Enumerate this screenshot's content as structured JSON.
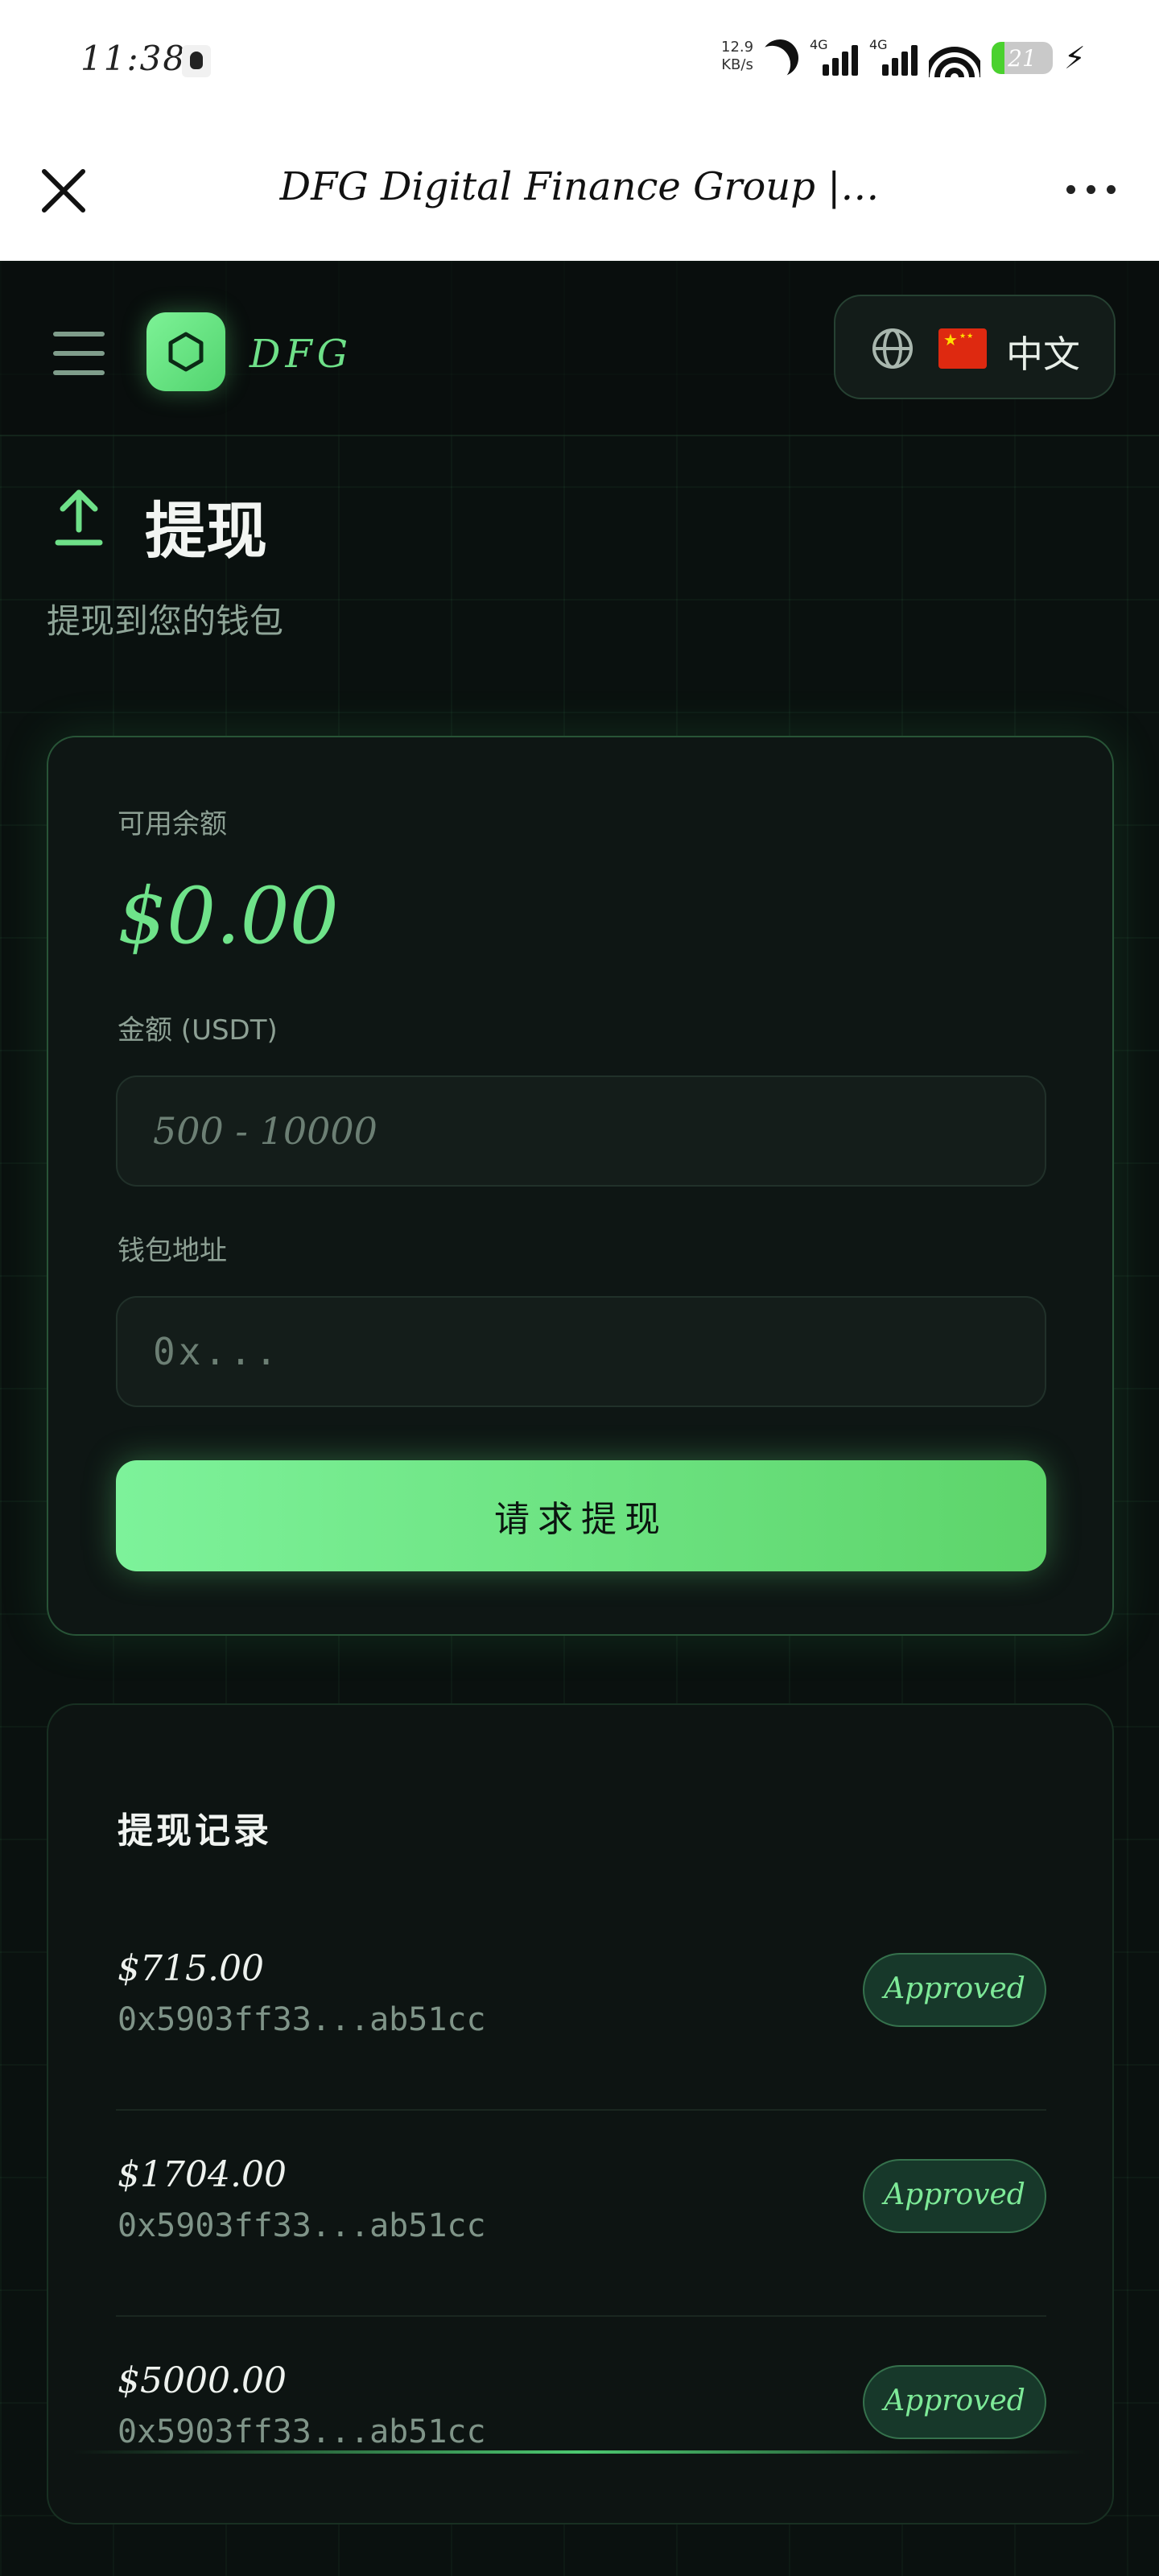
{
  "status_bar": {
    "time": "11:38",
    "net_speed_value": "12.9",
    "net_speed_unit": "KB/s",
    "sim1_label": "4G",
    "sim2_label": "4G",
    "battery_level": "21",
    "battery_fraction": 0.21,
    "battery_color": "#4ad12e"
  },
  "browser": {
    "title": "DFG Digital Finance Group |…",
    "close_icon": "close-icon",
    "more_icon": "more-dots-icon"
  },
  "header": {
    "brand": "DFG",
    "language": {
      "flag": "cn-flag-icon",
      "label": "中文"
    },
    "accent_color": "#6ee088"
  },
  "page": {
    "title": "提现",
    "subtitle": "提现到您的钱包"
  },
  "withdraw_form": {
    "balance_label": "可用余额",
    "balance_value": "$0.00",
    "amount_label": "金额 (USDT)",
    "amount_placeholder": "500 - 10000",
    "address_label": "钱包地址",
    "address_placeholder": "0x...",
    "submit_label": "请求提现"
  },
  "records": {
    "title": "提现记录",
    "items": [
      {
        "amount": "$715.00",
        "address": "0x5903ff33...ab51cc",
        "status": "Approved"
      },
      {
        "amount": "$1704.00",
        "address": "0x5903ff33...ab51cc",
        "status": "Approved"
      },
      {
        "amount": "$5000.00",
        "address": "0x5903ff33...ab51cc",
        "status": "Approved"
      }
    ]
  }
}
